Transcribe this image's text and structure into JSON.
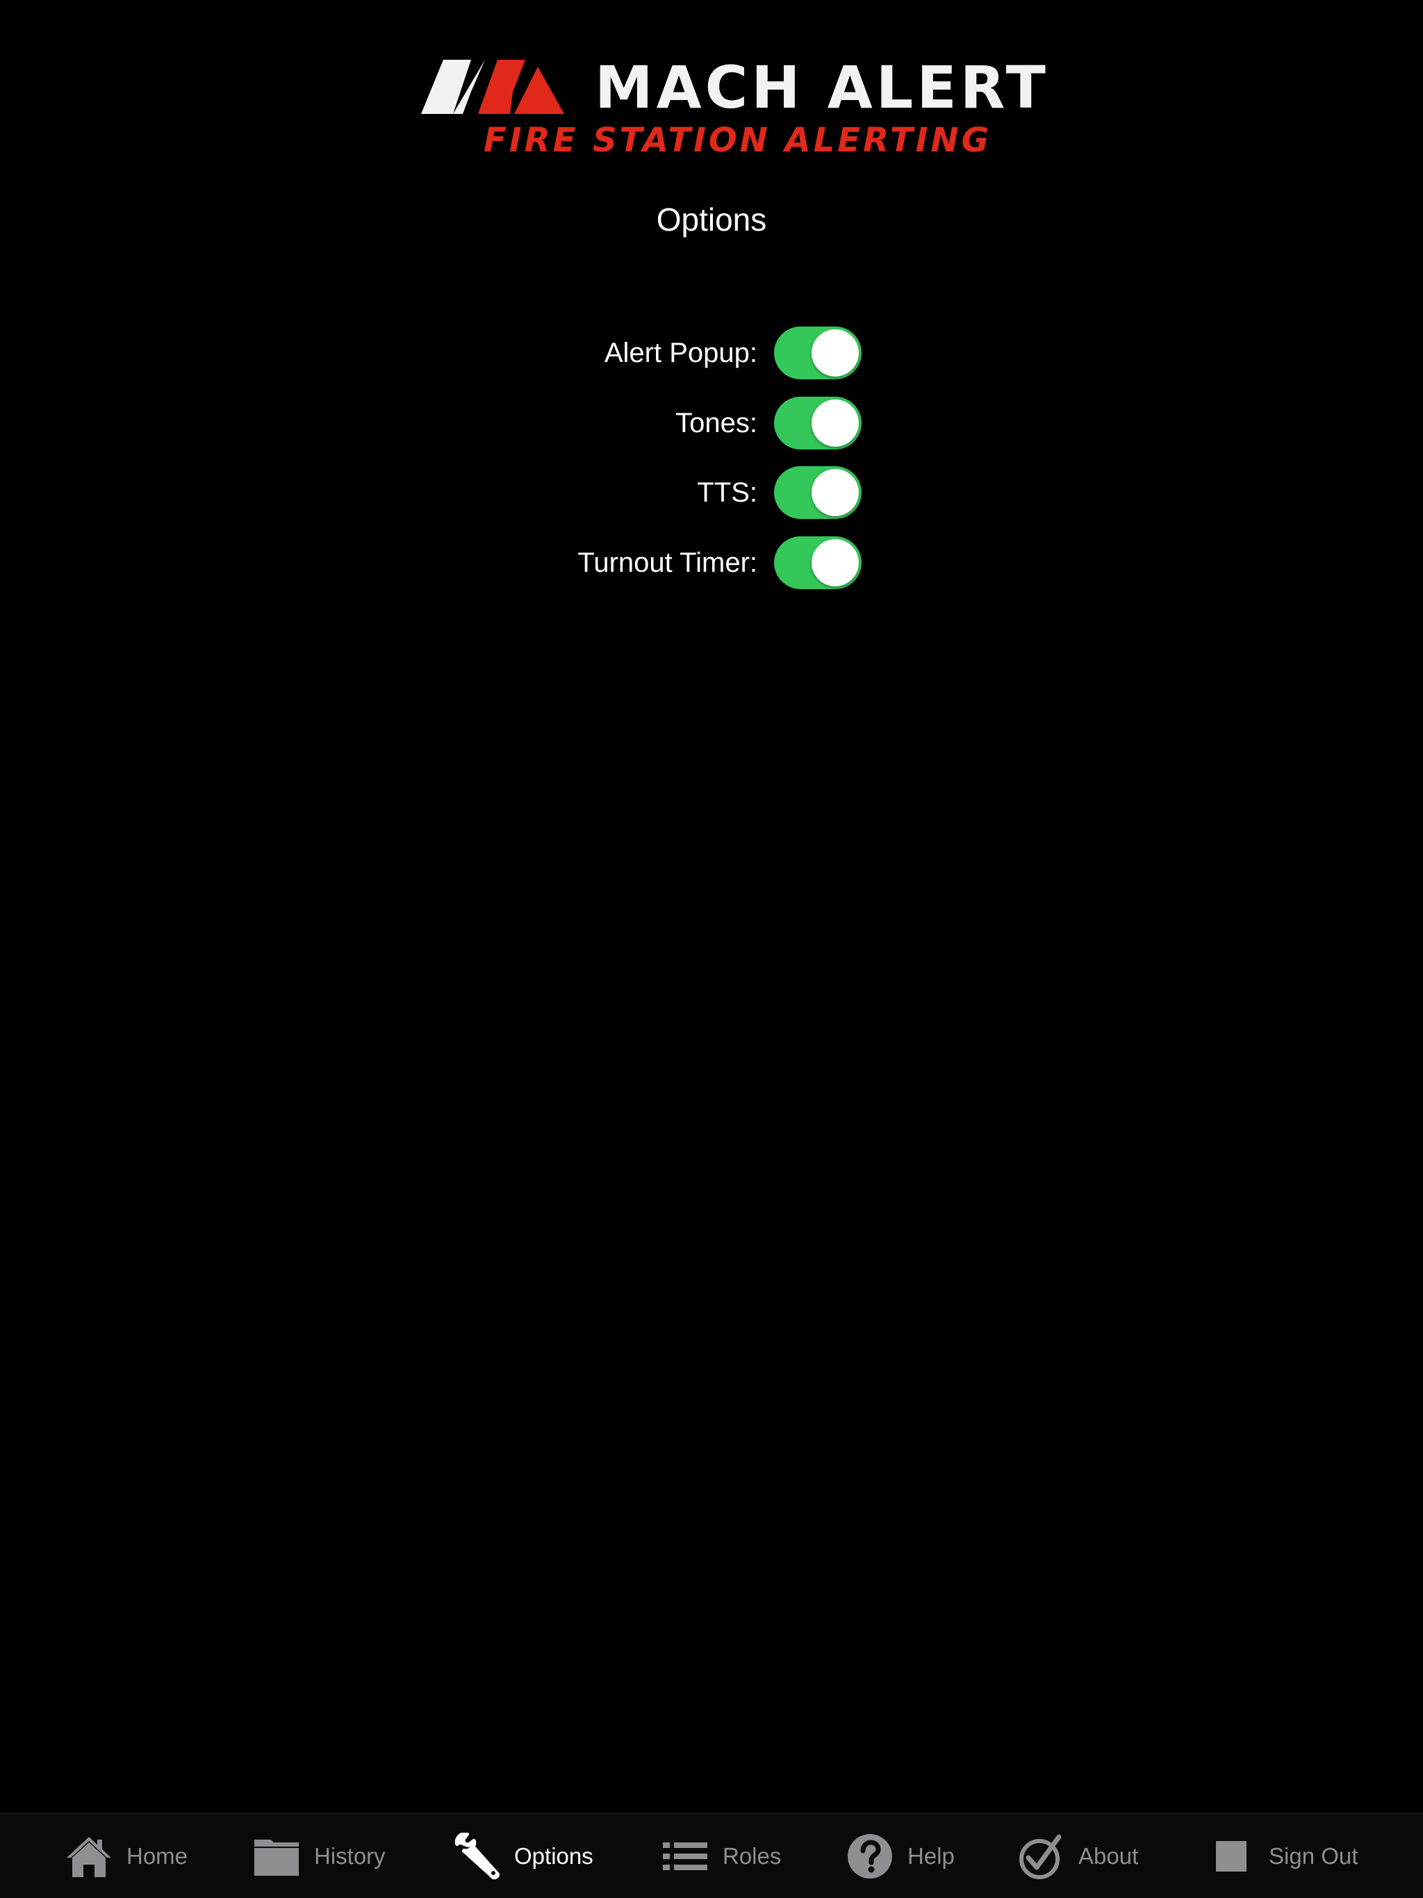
{
  "logo": {
    "title": "MACH ALERT",
    "tagline": "FIRE STATION ALERTING",
    "title_color": "#f2f2f2",
    "tagline_color": "#e0291b",
    "mark_left_color": "#f2f2f2",
    "mark_right_color": "#e0291b"
  },
  "page_title": "Options",
  "options": [
    {
      "label": "Alert Popup:",
      "enabled": true
    },
    {
      "label": "Tones:",
      "enabled": true
    },
    {
      "label": "TTS:",
      "enabled": true
    },
    {
      "label": "Turnout Timer:",
      "enabled": true
    }
  ],
  "tabs": [
    {
      "label": "Home",
      "icon": "house-icon",
      "active": false
    },
    {
      "label": "History",
      "icon": "folder-icon",
      "active": false
    },
    {
      "label": "Options",
      "icon": "wrench-icon",
      "active": true
    },
    {
      "label": "Roles",
      "icon": "list-icon",
      "active": false
    },
    {
      "label": "Help",
      "icon": "question-circle-icon",
      "active": false
    },
    {
      "label": "About",
      "icon": "checkmark-circle-icon",
      "active": false
    },
    {
      "label": "Sign Out",
      "icon": "stop-square-icon",
      "active": false
    }
  ],
  "colors": {
    "background": "#000000",
    "toggle_on": "#34c759",
    "tab_inactive": "#8e8e93",
    "tab_active": "#ffffff"
  }
}
